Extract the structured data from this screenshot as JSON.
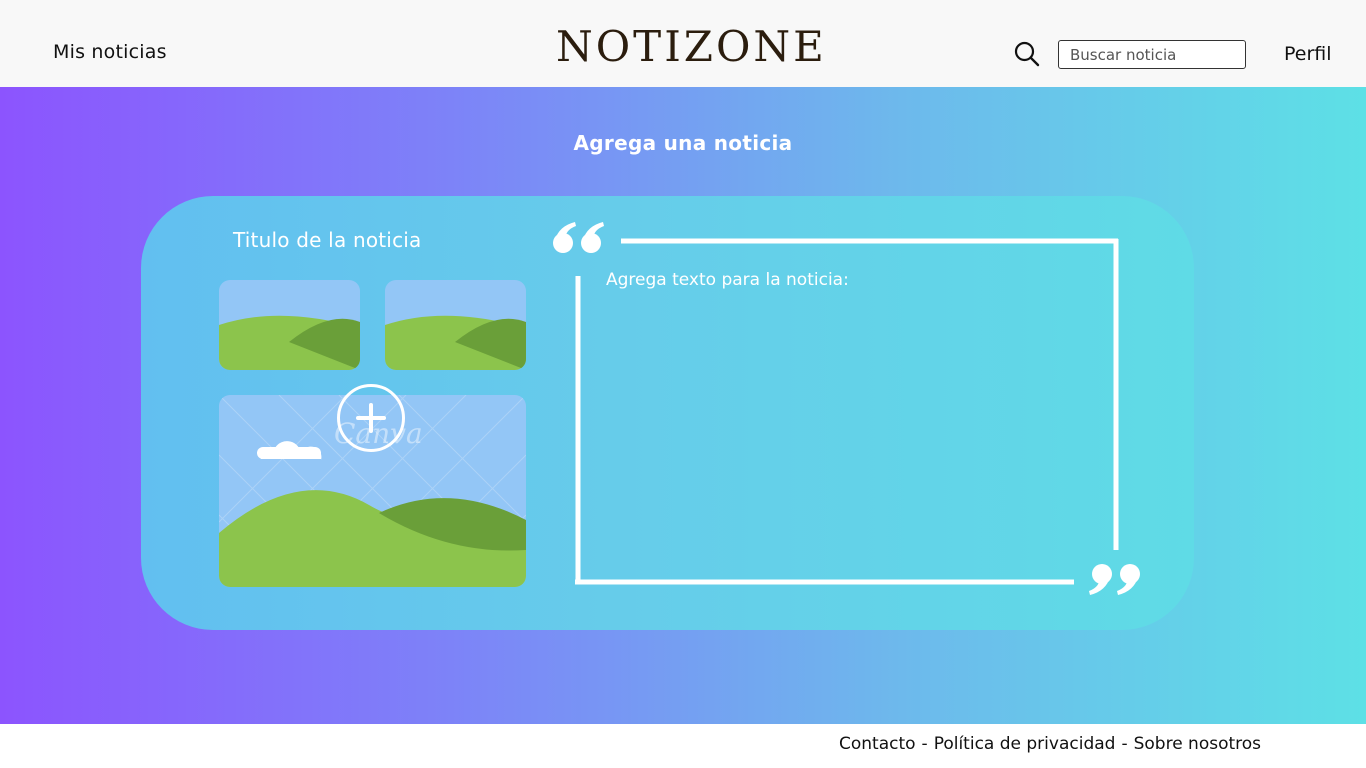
{
  "header": {
    "left_link": "Mis noticias",
    "logo": "NOTIZONE",
    "search_placeholder": "Buscar noticia",
    "right_link": "Perfil",
    "search_icon": "search-icon"
  },
  "main": {
    "title": "Agrega una noticia",
    "card": {
      "title": "Titulo de la noticia",
      "text_placeholder": "Agrega texto para la noticia:",
      "image_placeholders": [
        "image-placeholder",
        "image-placeholder",
        "image-placeholder"
      ],
      "add_icon": "plus-circle-icon",
      "quote_icons": [
        "open-quote-icon",
        "close-quote-icon"
      ],
      "watermark": "Canva"
    }
  },
  "footer": {
    "links": [
      "Contacto",
      "Política de privacidad",
      "Sobre nosotros"
    ],
    "separator": "-"
  },
  "colors": {
    "header_bg": "#f8f8f8",
    "gradient_start": "#8c54fe",
    "gradient_end": "#5de0e6",
    "card_bg": "#66ccea",
    "logo": "#2b1d0e",
    "text_on_gradient": "#ffffff"
  }
}
